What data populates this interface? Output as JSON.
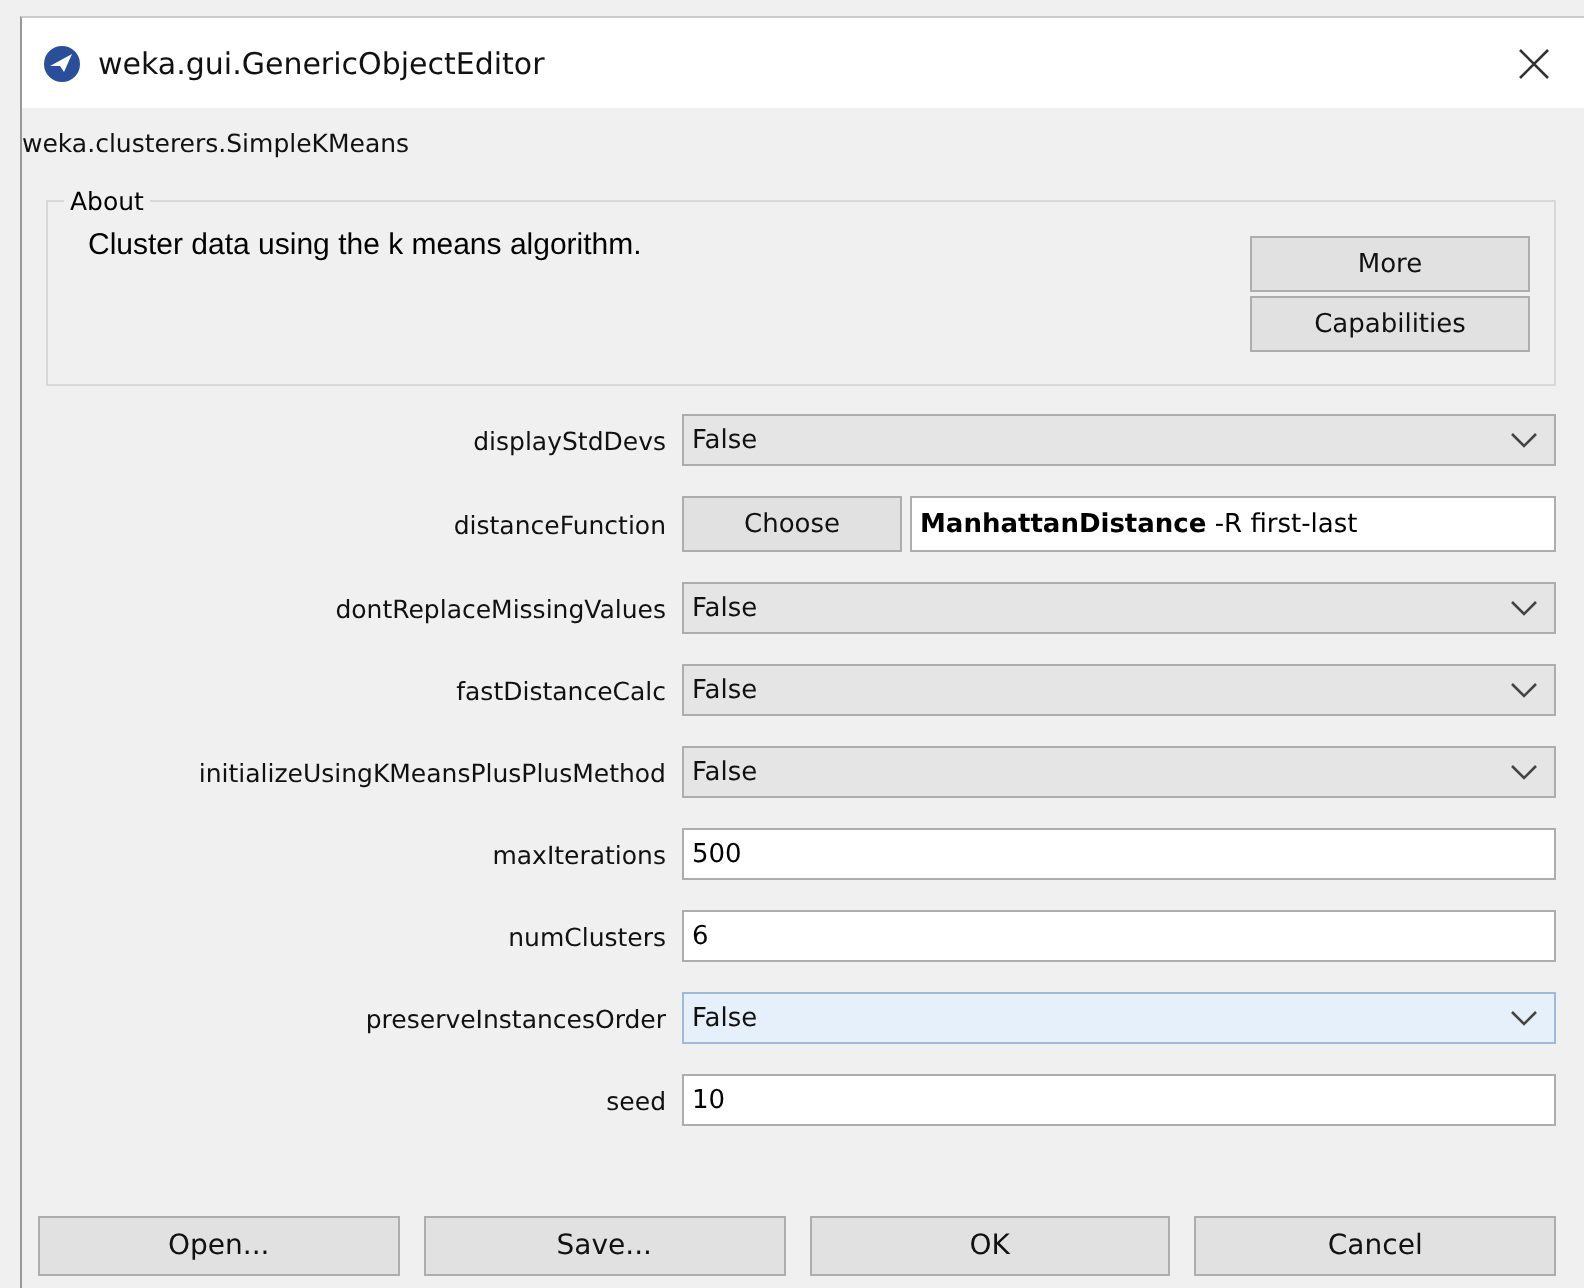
{
  "window": {
    "title": "weka.gui.GenericObjectEditor"
  },
  "class_name": "weka.clusterers.SimpleKMeans",
  "about": {
    "legend": "About",
    "text": "Cluster data using the k means algorithm.",
    "buttons": [
      "More",
      "Capabilities"
    ]
  },
  "properties": [
    {
      "label": "displayStdDevs",
      "kind": "dropdown",
      "value": "False",
      "focused": false
    },
    {
      "label": "distanceFunction",
      "kind": "chooser",
      "button": "Choose",
      "value": "**ManhattanDistance** -R first-last"
    },
    {
      "label": "dontReplaceMissingValues",
      "kind": "dropdown",
      "value": "False",
      "focused": false
    },
    {
      "label": "fastDistanceCalc",
      "kind": "dropdown",
      "value": "False",
      "focused": false
    },
    {
      "label": "initializeUsingKMeansPlusPlusMethod",
      "kind": "dropdown",
      "value": "False",
      "focused": false
    },
    {
      "label": "maxIterations",
      "kind": "text",
      "value": "500"
    },
    {
      "label": "numClusters",
      "kind": "text",
      "value": "6"
    },
    {
      "label": "preserveInstancesOrder",
      "kind": "dropdown",
      "value": "False",
      "focused": true
    },
    {
      "label": "seed",
      "kind": "text",
      "value": "10"
    }
  ],
  "buttons": [
    "Open...",
    "Save...",
    "OK",
    "Cancel"
  ]
}
